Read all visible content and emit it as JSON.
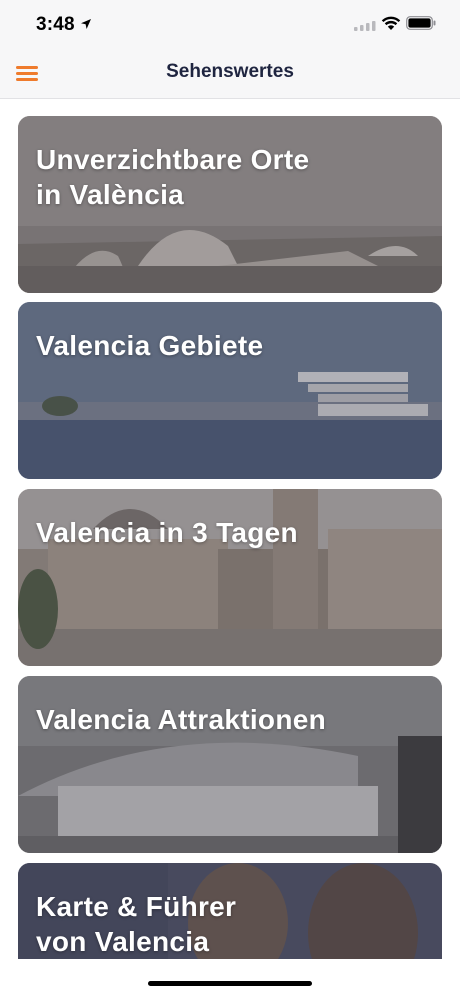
{
  "status_bar": {
    "time": "3:48"
  },
  "navbar": {
    "title": "Sehenswertes",
    "menu_icon": "hamburger-menu-icon",
    "accent_color": "#ef7b2c"
  },
  "cards": [
    {
      "title": "Unverzichtbare Orte\nin València",
      "image": "city-of-arts-and-sciences-photo"
    },
    {
      "title": "Valencia Gebiete",
      "image": "veles-e-vents-harbour-photo"
    },
    {
      "title": "Valencia in 3 Tagen",
      "image": "plaza-de-la-virgen-photo"
    },
    {
      "title": "Valencia Attraktionen",
      "image": "valencia-letters-sign-photo"
    },
    {
      "title": "Karte & Führer\nvon Valencia",
      "image": "travellers-with-map-photo"
    }
  ]
}
